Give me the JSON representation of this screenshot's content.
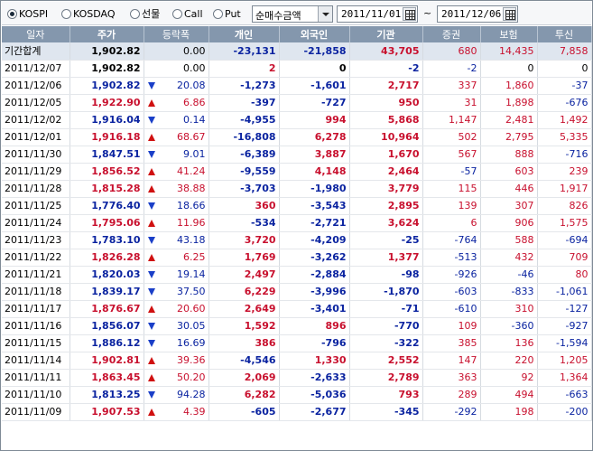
{
  "toolbar": {
    "markets": [
      {
        "label": "KOSPI",
        "selected": true
      },
      {
        "label": "KOSDAQ",
        "selected": false
      },
      {
        "label": "선물",
        "selected": false
      },
      {
        "label": "Call",
        "selected": false
      },
      {
        "label": "Put",
        "selected": false
      }
    ],
    "metric_select": "순매수금액",
    "start_date": "2011/11/01",
    "separator": "~",
    "end_date": "2011/12/06"
  },
  "colors": {
    "header_bg": "#8497ad",
    "up": "#c8102e",
    "down": "#0a23a0",
    "total_row_bg": "#dfe6ef"
  },
  "table": {
    "headers": [
      "일자",
      "주가",
      "등락폭",
      "개인",
      "외국인",
      "기관",
      "증권",
      "보험",
      "투신"
    ],
    "rows": [
      {
        "date": "기간합계",
        "price": "1,902.82",
        "dir": "",
        "change": "0.00",
        "indiv": "-23,131",
        "foreign": "-21,858",
        "inst": "43,705",
        "sec": "680",
        "ins": "14,435",
        "trust": "7,858",
        "total": true
      },
      {
        "date": "2011/12/07",
        "price": "1,902.82",
        "dir": "",
        "change": "0.00",
        "indiv": "2",
        "foreign": "0",
        "inst": "-2",
        "sec": "-2",
        "ins": "0",
        "trust": "0"
      },
      {
        "date": "2011/12/06",
        "price": "1,902.82",
        "dir": "dn",
        "change": "20.08",
        "indiv": "-1,273",
        "foreign": "-1,601",
        "inst": "2,717",
        "sec": "337",
        "ins": "1,860",
        "trust": "-37"
      },
      {
        "date": "2011/12/05",
        "price": "1,922.90",
        "dir": "up",
        "change": "6.86",
        "indiv": "-397",
        "foreign": "-727",
        "inst": "950",
        "sec": "31",
        "ins": "1,898",
        "trust": "-676"
      },
      {
        "date": "2011/12/02",
        "price": "1,916.04",
        "dir": "dn",
        "change": "0.14",
        "indiv": "-4,955",
        "foreign": "994",
        "inst": "5,868",
        "sec": "1,147",
        "ins": "2,481",
        "trust": "1,492"
      },
      {
        "date": "2011/12/01",
        "price": "1,916.18",
        "dir": "up",
        "change": "68.67",
        "indiv": "-16,808",
        "foreign": "6,278",
        "inst": "10,964",
        "sec": "502",
        "ins": "2,795",
        "trust": "5,335"
      },
      {
        "date": "2011/11/30",
        "price": "1,847.51",
        "dir": "dn",
        "change": "9.01",
        "indiv": "-6,389",
        "foreign": "3,887",
        "inst": "1,670",
        "sec": "567",
        "ins": "888",
        "trust": "-716"
      },
      {
        "date": "2011/11/29",
        "price": "1,856.52",
        "dir": "up",
        "change": "41.24",
        "indiv": "-9,559",
        "foreign": "4,148",
        "inst": "2,464",
        "sec": "-57",
        "ins": "603",
        "trust": "239"
      },
      {
        "date": "2011/11/28",
        "price": "1,815.28",
        "dir": "up",
        "change": "38.88",
        "indiv": "-3,703",
        "foreign": "-1,980",
        "inst": "3,779",
        "sec": "115",
        "ins": "446",
        "trust": "1,917"
      },
      {
        "date": "2011/11/25",
        "price": "1,776.40",
        "dir": "dn",
        "change": "18.66",
        "indiv": "360",
        "foreign": "-3,543",
        "inst": "2,895",
        "sec": "139",
        "ins": "307",
        "trust": "826"
      },
      {
        "date": "2011/11/24",
        "price": "1,795.06",
        "dir": "up",
        "change": "11.96",
        "indiv": "-534",
        "foreign": "-2,721",
        "inst": "3,624",
        "sec": "6",
        "ins": "906",
        "trust": "1,575"
      },
      {
        "date": "2011/11/23",
        "price": "1,783.10",
        "dir": "dn",
        "change": "43.18",
        "indiv": "3,720",
        "foreign": "-4,209",
        "inst": "-25",
        "sec": "-764",
        "ins": "588",
        "trust": "-694"
      },
      {
        "date": "2011/11/22",
        "price": "1,826.28",
        "dir": "up",
        "change": "6.25",
        "indiv": "1,769",
        "foreign": "-3,262",
        "inst": "1,377",
        "sec": "-513",
        "ins": "432",
        "trust": "709"
      },
      {
        "date": "2011/11/21",
        "price": "1,820.03",
        "dir": "dn",
        "change": "19.14",
        "indiv": "2,497",
        "foreign": "-2,884",
        "inst": "-98",
        "sec": "-926",
        "ins": "-46",
        "trust": "80"
      },
      {
        "date": "2011/11/18",
        "price": "1,839.17",
        "dir": "dn",
        "change": "37.50",
        "indiv": "6,229",
        "foreign": "-3,996",
        "inst": "-1,870",
        "sec": "-603",
        "ins": "-833",
        "trust": "-1,061"
      },
      {
        "date": "2011/11/17",
        "price": "1,876.67",
        "dir": "up",
        "change": "20.60",
        "indiv": "2,649",
        "foreign": "-3,401",
        "inst": "-71",
        "sec": "-610",
        "ins": "310",
        "trust": "-127"
      },
      {
        "date": "2011/11/16",
        "price": "1,856.07",
        "dir": "dn",
        "change": "30.05",
        "indiv": "1,592",
        "foreign": "896",
        "inst": "-770",
        "sec": "109",
        "ins": "-360",
        "trust": "-927"
      },
      {
        "date": "2011/11/15",
        "price": "1,886.12",
        "dir": "dn",
        "change": "16.69",
        "indiv": "386",
        "foreign": "-796",
        "inst": "-322",
        "sec": "385",
        "ins": "136",
        "trust": "-1,594"
      },
      {
        "date": "2011/11/14",
        "price": "1,902.81",
        "dir": "up",
        "change": "39.36",
        "indiv": "-4,546",
        "foreign": "1,330",
        "inst": "2,552",
        "sec": "147",
        "ins": "220",
        "trust": "1,205"
      },
      {
        "date": "2011/11/11",
        "price": "1,863.45",
        "dir": "up",
        "change": "50.20",
        "indiv": "2,069",
        "foreign": "-2,633",
        "inst": "2,789",
        "sec": "363",
        "ins": "92",
        "trust": "1,364"
      },
      {
        "date": "2011/11/10",
        "price": "1,813.25",
        "dir": "dn",
        "change": "94.28",
        "indiv": "6,282",
        "foreign": "-5,036",
        "inst": "793",
        "sec": "289",
        "ins": "494",
        "trust": "-663"
      },
      {
        "date": "2011/11/09",
        "price": "1,907.53",
        "dir": "up",
        "change": "4.39",
        "indiv": "-605",
        "foreign": "-2,677",
        "inst": "-345",
        "sec": "-292",
        "ins": "198",
        "trust": "-200"
      }
    ]
  }
}
